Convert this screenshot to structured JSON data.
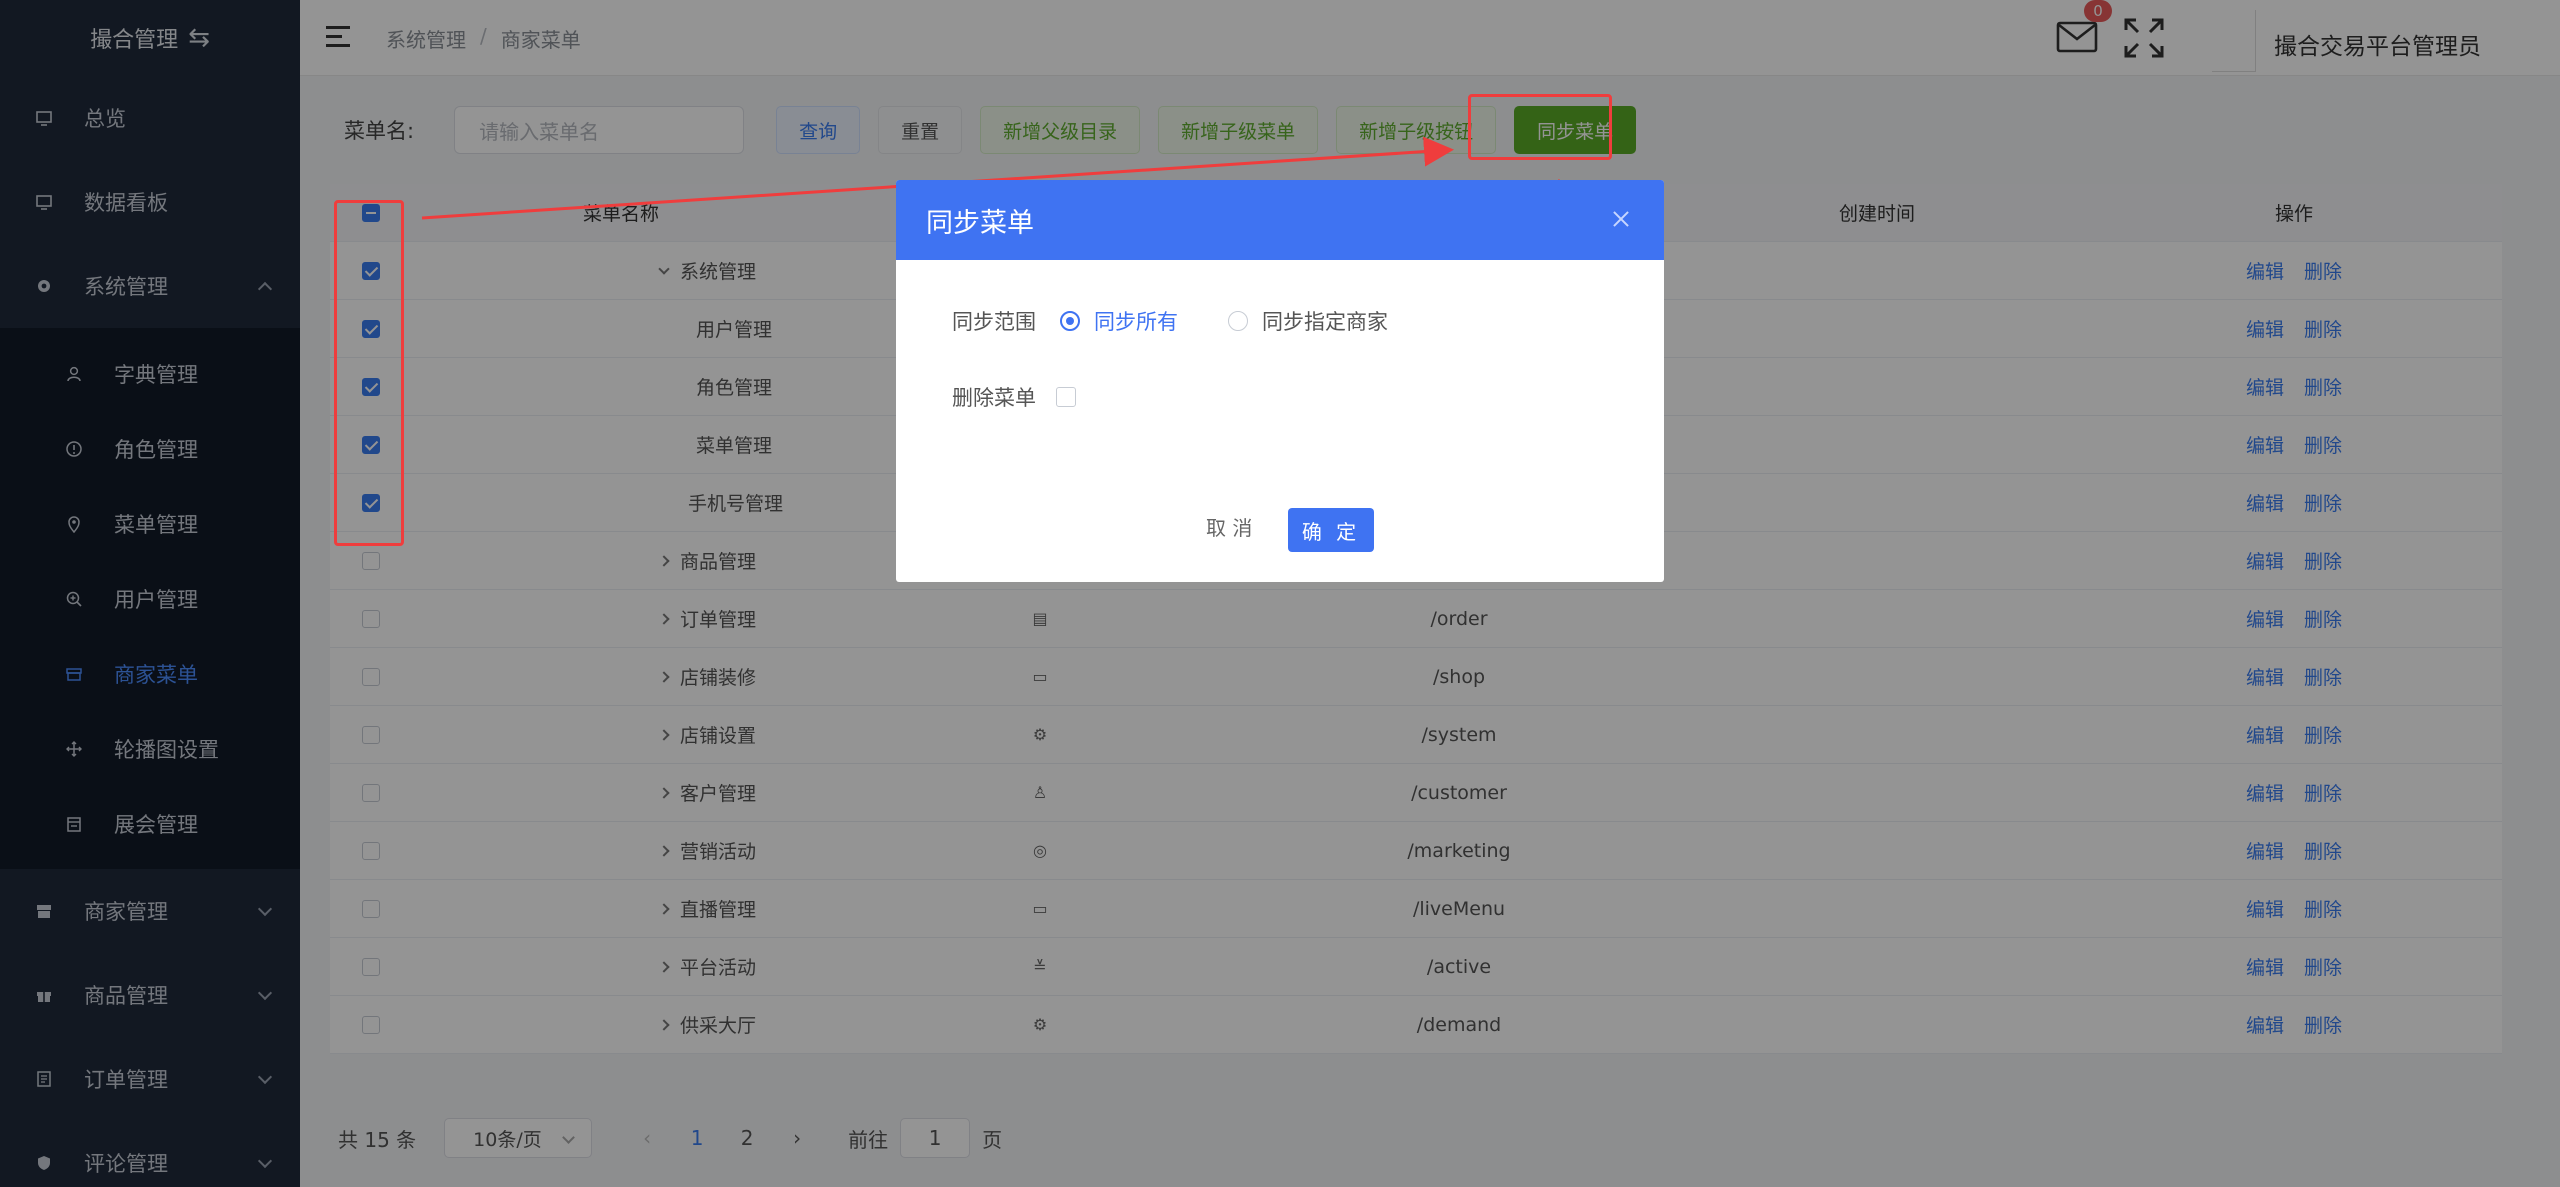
{
  "sidebar": {
    "title": "撮合管理",
    "items": [
      {
        "label": "总览"
      },
      {
        "label": "数据看板"
      },
      {
        "label": "系统管理"
      }
    ],
    "sub_items": [
      {
        "label": "字典管理"
      },
      {
        "label": "角色管理"
      },
      {
        "label": "菜单管理"
      },
      {
        "label": "用户管理"
      },
      {
        "label": "商家菜单"
      },
      {
        "label": "轮播图设置"
      },
      {
        "label": "展会管理"
      }
    ],
    "bottom_items": [
      {
        "label": "商家管理"
      },
      {
        "label": "商品管理"
      },
      {
        "label": "订单管理"
      },
      {
        "label": "评论管理"
      }
    ]
  },
  "header": {
    "breadcrumb": [
      "系统管理",
      "商家菜单"
    ],
    "breadcrumb_sep": "/",
    "mail_badge": "0",
    "username": "撮合交易平台管理员"
  },
  "search": {
    "label": "菜单名:",
    "placeholder": "请输入菜单名",
    "buttons": [
      "查询",
      "重置",
      "新增父级目录",
      "新增子级菜单",
      "新增子级按钮",
      "同步菜单"
    ]
  },
  "table": {
    "columns": {
      "name": "菜单名称",
      "time": "创建时间",
      "ops": "操作"
    },
    "edit_label": "编辑",
    "delete_label": "删除",
    "rows": [
      {
        "name": "系统管理",
        "path": ""
      },
      {
        "name": "用户管理",
        "path": ""
      },
      {
        "name": "角色管理",
        "path": ""
      },
      {
        "name": "菜单管理",
        "path": ""
      },
      {
        "name": "手机号管理",
        "path": ""
      },
      {
        "name": "商品管理",
        "path": ""
      },
      {
        "name": "订单管理",
        "path": "/order"
      },
      {
        "name": "店铺装修",
        "path": "/shop"
      },
      {
        "name": "店铺设置",
        "path": "/system"
      },
      {
        "name": "客户管理",
        "path": "/customer"
      },
      {
        "name": "营销活动",
        "path": "/marketing"
      },
      {
        "name": "直播管理",
        "path": "/liveMenu"
      },
      {
        "name": "平台活动",
        "path": "/active"
      },
      {
        "name": "供采大厅",
        "path": "/demand"
      }
    ]
  },
  "pager": {
    "total": "共 15 条",
    "page_size": "10条/页",
    "pages": [
      "1",
      "2"
    ],
    "goto_label": "前往",
    "goto_value": "1",
    "page_suffix": "页"
  },
  "modal": {
    "title": "同步菜单",
    "scope_label": "同步范围",
    "option_all": "同步所有",
    "option_specific": "同步指定商家",
    "delete_label": "删除菜单",
    "cancel": "取 消",
    "ok": "确 定"
  },
  "colors": {
    "sidebar_bg": "#1f2a3b",
    "accent": "#3f73f2",
    "green": "#5aab27",
    "annotation_red": "#ef3d3d"
  }
}
